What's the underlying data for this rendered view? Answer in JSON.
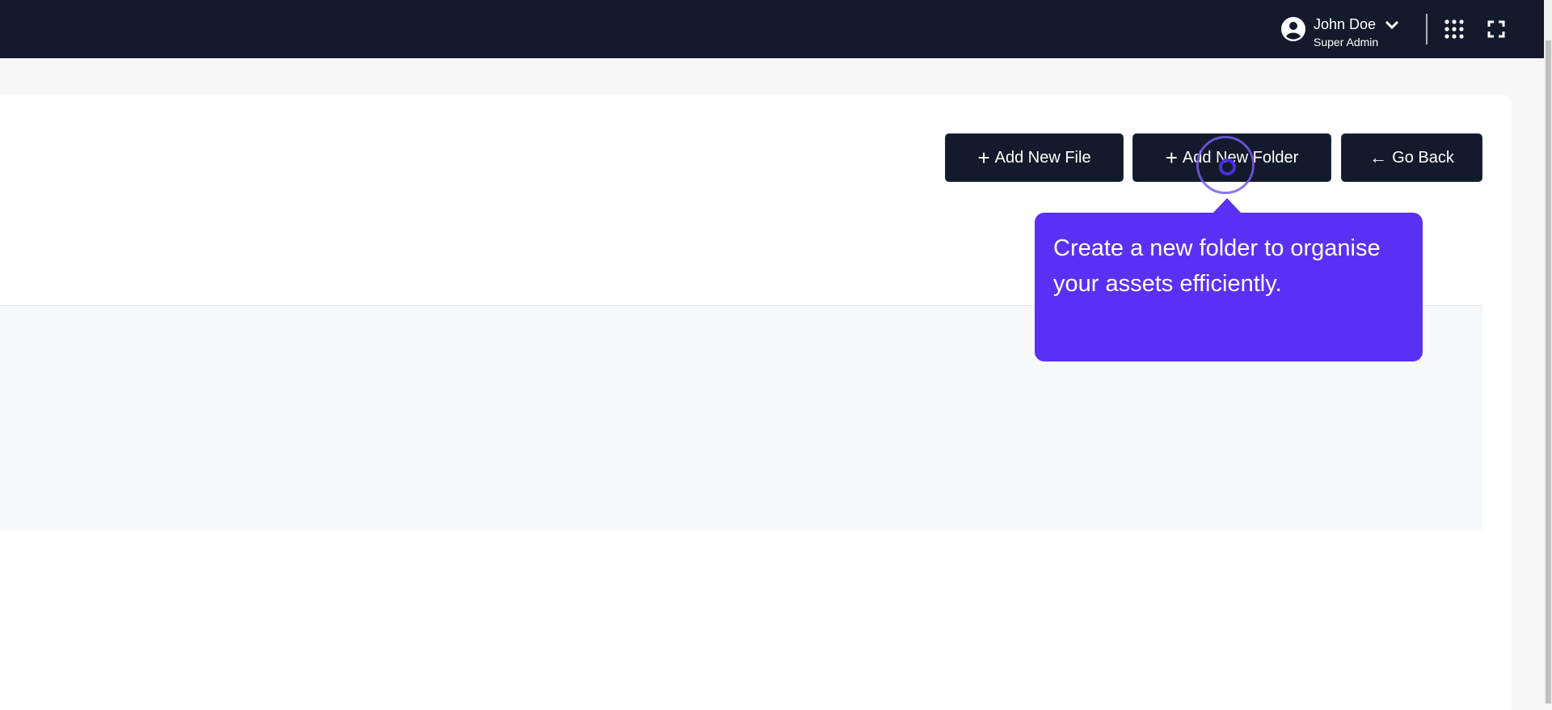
{
  "header": {
    "user_name": "John Doe",
    "user_role": "Super Admin",
    "icons": [
      "user-avatar-icon",
      "chevron-down-icon",
      "apps-grid-icon",
      "fullscreen-icon"
    ]
  },
  "toolbar": {
    "add_file_label": "Add New File",
    "add_folder_label": "Add New Folder",
    "go_back_label": "Go Back"
  },
  "tooltip": {
    "text": "Create a new folder to organise your assets efficiently."
  },
  "colors": {
    "header": "#131a2b",
    "accent": "#5a31f4",
    "button": "#131a2b"
  }
}
